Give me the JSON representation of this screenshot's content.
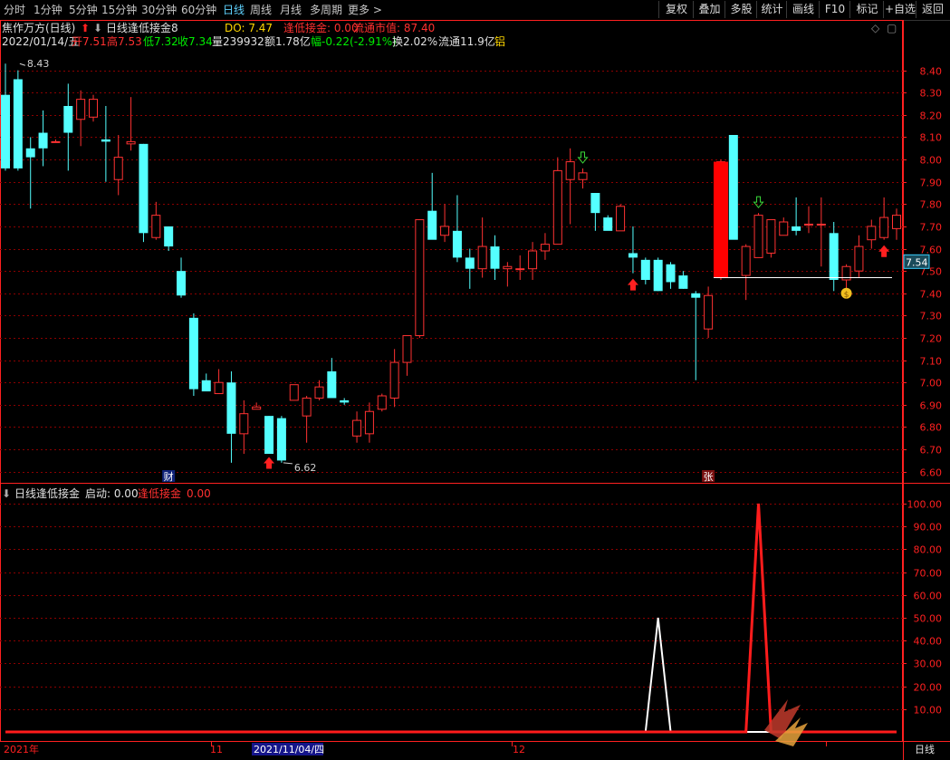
{
  "toolbar": {
    "periods": [
      "分时",
      "1分钟",
      "5分钟",
      "15分钟",
      "30分钟",
      "60分钟",
      "日线",
      "周线",
      "月线",
      "多周期",
      "更多 >"
    ],
    "active_period": "日线",
    "right_buttons": [
      "复权",
      "叠加",
      "多股",
      "统计",
      "画线",
      "F10",
      "标记",
      "+自选",
      "返回"
    ]
  },
  "header": {
    "stock_title": "焦作万方(日线)",
    "indicator_name": "日线逢低接金8",
    "do_label": "DO: 7.47",
    "signal_label": "逢低接金: 0.00",
    "market_cap_label": "流通市值: 87.40"
  },
  "quote": {
    "date": "2022/01/14/五",
    "open": "开7.51",
    "high": "高7.53",
    "low": "低7.32",
    "close": "收7.34",
    "volume": "量239932",
    "amount": "额1.78亿",
    "change": "幅-0.22(-2.91%)",
    "turnover": "换2.02%",
    "float_shares": "流通11.9亿",
    "sector": "铝"
  },
  "sub_header": {
    "name": "日线逢低接金",
    "start_label": "启动: 0.00",
    "signal_label": "逢低接金",
    "signal_value": "0.00"
  },
  "badges": {
    "cai": "财",
    "zhang": "张"
  },
  "colors": {
    "up": "#ff3232",
    "down": "#54ffff",
    "grid": "#8b0000",
    "axis": "#ff2020",
    "white": "#ffffff",
    "hilite": "#ff0000",
    "text": "#c0c0c0"
  },
  "chart_data": {
    "type": "candlestick",
    "price_axis": {
      "min": 6.55,
      "max": 8.5,
      "ticks": [
        "8.40",
        "8.30",
        "8.20",
        "8.10",
        "8.00",
        "7.90",
        "7.80",
        "7.70",
        "7.60",
        "7.50",
        "7.40",
        "7.30",
        "7.20",
        "7.10",
        "7.00",
        "6.90",
        "6.80",
        "6.70",
        "6.60"
      ]
    },
    "current_price_label": "7.54",
    "high_annotation": "8.43",
    "low_annotation": "6.62",
    "do_line": 7.47,
    "x_axis_labels": [
      "2021年",
      "11",
      "2021/11/04/四",
      "12",
      "日线"
    ],
    "candles": [
      [
        8.29,
        8.43,
        7.95,
        7.96
      ],
      [
        8.36,
        8.4,
        7.95,
        7.96
      ],
      [
        8.05,
        8.1,
        7.78,
        8.01
      ],
      [
        8.12,
        8.22,
        7.97,
        8.05
      ],
      [
        8.08,
        8.09,
        8.08,
        8.08
      ],
      [
        8.24,
        8.34,
        7.95,
        8.12
      ],
      [
        8.18,
        8.31,
        8.06,
        8.27
      ],
      [
        8.19,
        8.29,
        8.17,
        8.27
      ],
      [
        8.09,
        8.24,
        7.9,
        8.08
      ],
      [
        7.91,
        8.11,
        7.84,
        8.01
      ],
      [
        8.07,
        8.28,
        8.04,
        8.08
      ],
      [
        8.07,
        8.07,
        7.63,
        7.67
      ],
      [
        7.65,
        7.81,
        7.64,
        7.75
      ],
      [
        7.7,
        7.7,
        7.59,
        7.61
      ],
      [
        7.5,
        7.56,
        7.38,
        7.39
      ],
      [
        7.29,
        7.31,
        6.94,
        6.97
      ],
      [
        7.01,
        7.04,
        6.97,
        6.96
      ],
      [
        6.95,
        7.06,
        6.95,
        7.0
      ],
      [
        7.0,
        7.05,
        6.64,
        6.77
      ],
      [
        6.77,
        6.92,
        6.68,
        6.86
      ],
      [
        6.88,
        6.91,
        6.88,
        6.89
      ],
      [
        6.85,
        6.85,
        6.69,
        6.68
      ],
      [
        6.84,
        6.85,
        6.64,
        6.65
      ],
      [
        6.92,
        6.99,
        6.92,
        6.99
      ],
      [
        6.85,
        6.94,
        6.73,
        6.93
      ],
      [
        6.93,
        7.01,
        6.92,
        6.98
      ],
      [
        7.05,
        7.11,
        6.96,
        6.93
      ],
      [
        6.92,
        6.93,
        6.9,
        6.91
      ],
      [
        6.76,
        6.87,
        6.73,
        6.83
      ],
      [
        6.77,
        6.91,
        6.73,
        6.87
      ],
      [
        6.88,
        6.95,
        6.87,
        6.94
      ],
      [
        6.93,
        7.15,
        6.89,
        7.09
      ],
      [
        7.09,
        7.2,
        7.03,
        7.21
      ],
      [
        7.21,
        7.58,
        7.2,
        7.73
      ],
      [
        7.77,
        7.94,
        7.68,
        7.64
      ],
      [
        7.66,
        7.8,
        7.63,
        7.7
      ],
      [
        7.68,
        7.84,
        7.54,
        7.56
      ],
      [
        7.56,
        7.6,
        7.42,
        7.51
      ],
      [
        7.51,
        7.74,
        7.47,
        7.61
      ],
      [
        7.61,
        7.66,
        7.46,
        7.51
      ],
      [
        7.51,
        7.54,
        7.43,
        7.52
      ],
      [
        7.51,
        7.57,
        7.46,
        7.51
      ],
      [
        7.51,
        7.63,
        7.46,
        7.59
      ],
      [
        7.59,
        7.67,
        7.55,
        7.62
      ],
      [
        7.62,
        8.01,
        7.77,
        7.95
      ],
      [
        7.91,
        8.05,
        7.71,
        7.99
      ],
      [
        7.91,
        7.96,
        7.87,
        7.94
      ],
      [
        7.85,
        7.84,
        7.68,
        7.76
      ],
      [
        7.74,
        7.75,
        7.71,
        7.68
      ],
      [
        7.68,
        7.8,
        7.77,
        7.79
      ],
      [
        7.58,
        7.7,
        7.49,
        7.56
      ],
      [
        7.55,
        7.56,
        7.44,
        7.46
      ],
      [
        7.55,
        7.56,
        7.41,
        7.41
      ],
      [
        7.53,
        7.54,
        7.42,
        7.45
      ],
      [
        7.48,
        7.5,
        7.42,
        7.42
      ],
      [
        7.4,
        7.41,
        7.01,
        7.38
      ],
      [
        7.24,
        7.43,
        7.2,
        7.39
      ],
      [
        7.47,
        8.0,
        7.46,
        7.99
      ],
      [
        8.11,
        8.11,
        7.65,
        7.64
      ],
      [
        7.48,
        7.62,
        7.37,
        7.61
      ],
      [
        7.56,
        7.76,
        7.56,
        7.75
      ],
      [
        7.58,
        7.7,
        7.56,
        7.73
      ],
      [
        7.66,
        7.74,
        7.66,
        7.72
      ],
      [
        7.7,
        7.83,
        7.66,
        7.68
      ],
      [
        7.71,
        7.79,
        7.67,
        7.71
      ],
      [
        7.71,
        7.83,
        7.52,
        7.71
      ],
      [
        7.67,
        7.72,
        7.41,
        7.46
      ],
      [
        7.46,
        7.53,
        7.39,
        7.52
      ],
      [
        7.5,
        7.66,
        7.47,
        7.61
      ],
      [
        7.64,
        7.73,
        7.6,
        7.7
      ],
      [
        7.65,
        7.83,
        7.64,
        7.74
      ],
      [
        7.69,
        7.78,
        7.64,
        7.75
      ]
    ],
    "signal_up_arrows": [
      21,
      50,
      70
    ],
    "signal_down_arrows": [
      46,
      60
    ],
    "sub_axis": {
      "min": 0,
      "max": 100,
      "ticks": [
        "100.00",
        "90.00",
        "80.00",
        "70.00",
        "60.00",
        "50.00",
        "40.00",
        "30.00",
        "20.00",
        "10.00"
      ]
    },
    "sub_series": [
      {
        "color": "white",
        "peak_index": 52,
        "peak_value": 50
      },
      {
        "color": "red",
        "peak_index": 60,
        "peak_value": 100
      }
    ]
  }
}
